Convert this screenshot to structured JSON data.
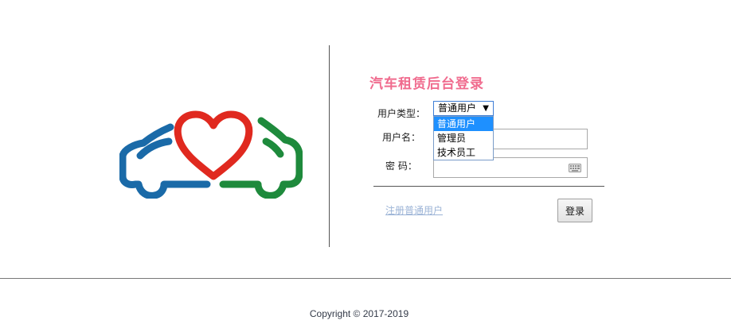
{
  "login": {
    "title": "汽车租赁后台登录",
    "user_type_label": "用户类型：",
    "username_label": "用户名：",
    "password_label": "密 码：",
    "user_type": {
      "selected": "普通用户",
      "options": [
        "普通用户",
        "管理员",
        "技术员工"
      ]
    },
    "username_value": "",
    "password_value": "",
    "register_link": "注册普通用户",
    "login_button": "登录"
  },
  "footer": {
    "copyright": "Copyright © 2017-2019"
  },
  "colors": {
    "title": "#f06b8e",
    "logo_blue": "#1a6aa8",
    "logo_green": "#1e8a3c",
    "logo_heart": "#e0291f",
    "dropdown_highlight": "#1e90ff",
    "link": "#9bb3d6"
  },
  "icons": {
    "logo": "car-heart-logo",
    "keyboard": "keyboard-icon",
    "dropdown_arrow": "triangle-down"
  }
}
